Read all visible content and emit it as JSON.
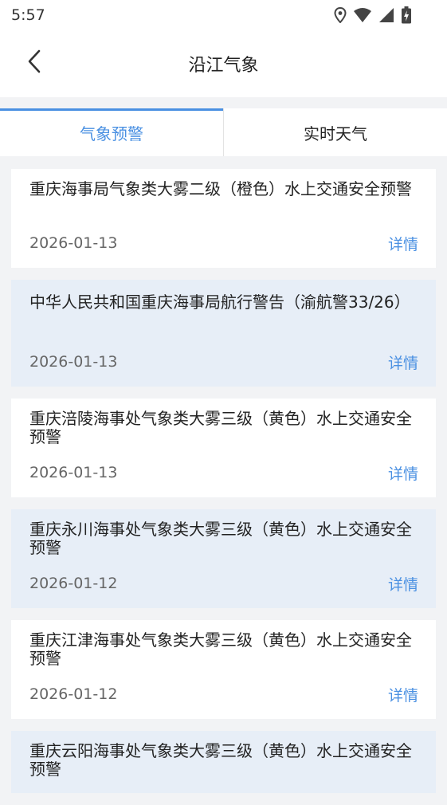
{
  "status_bar": {
    "time": "5:57",
    "icons": [
      "location-icon",
      "wifi-icon",
      "signal-icon",
      "battery-charging-icon"
    ]
  },
  "header": {
    "title": "沿江气象",
    "back_icon": "chevron-left-icon"
  },
  "tabs": [
    {
      "label": "气象预警",
      "active": true
    },
    {
      "label": "实时天气",
      "active": false
    }
  ],
  "notices": [
    {
      "title": "重庆海事局气象类大雾二级（橙色）水上交通安全预警",
      "date": "2026-01-13",
      "action": "详情"
    },
    {
      "title": "中华人民共和国重庆海事局航行警告（渝航警33/26）",
      "date": "2026-01-13",
      "action": "详情"
    },
    {
      "title": "重庆涪陵海事处气象类大雾三级（黄色）水上交通安全预警",
      "date": "2026-01-13",
      "action": "详情"
    },
    {
      "title": "重庆永川海事处气象类大雾三级（黄色）水上交通安全预警",
      "date": "2026-01-12",
      "action": "详情"
    },
    {
      "title": "重庆江津海事处气象类大雾三级（黄色）水上交通安全预警",
      "date": "2026-01-12",
      "action": "详情"
    },
    {
      "title": "重庆云阳海事处气象类大雾三级（黄色）水上交通安全预警",
      "date": "",
      "action": ""
    }
  ],
  "colors": {
    "accent": "#4a90e2",
    "alt_card_bg": "#e7eef7",
    "page_bg": "#f2f3f5"
  }
}
